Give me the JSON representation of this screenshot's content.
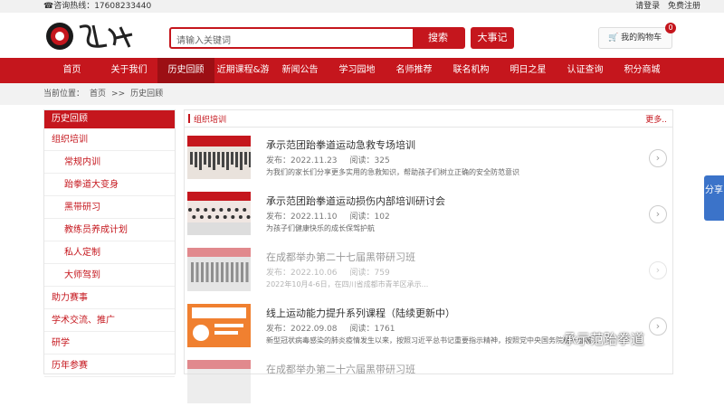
{
  "topbar": {
    "hotline": "☎咨询热线：17608233440",
    "login": "请登录",
    "register": "免费注册"
  },
  "header": {
    "search_placeholder": "请输入关键词",
    "search_button": "搜索",
    "big_event_button": "大事记",
    "cart_label": "我的购物车",
    "cart_count": "0"
  },
  "nav": {
    "items": [
      "首页",
      "关于我们",
      "历史回顾",
      "近期课程&游学",
      "新闻公告",
      "学习园地",
      "名师推荐",
      "联名机构",
      "明日之星",
      "认证查询",
      "积分商城"
    ],
    "active_index": 2
  },
  "breadcrumb": {
    "label": "当前位置：",
    "home": "首页",
    "sep": ">>",
    "current": "历史回顾"
  },
  "sidebar": {
    "title": "历史回顾",
    "items": [
      {
        "label": "组织培训",
        "sub": false
      },
      {
        "label": "常规内训",
        "sub": true
      },
      {
        "label": "跆拳道大变身",
        "sub": true
      },
      {
        "label": "黑带研习",
        "sub": true
      },
      {
        "label": "教练员养成计划",
        "sub": true
      },
      {
        "label": "私人定制",
        "sub": true
      },
      {
        "label": "大师驾到",
        "sub": true
      },
      {
        "label": "助力赛事",
        "sub": false
      },
      {
        "label": "学术交流、推广",
        "sub": false
      },
      {
        "label": "研学",
        "sub": false
      },
      {
        "label": "历年参赛",
        "sub": false
      }
    ]
  },
  "main": {
    "title": "组织培训",
    "more": "更多..",
    "articles": [
      {
        "title": "承示范团跆拳道运动急救专场培训",
        "date_label": "发布：2022.11.23",
        "views_label": "阅读：325",
        "desc": "为我们的家长们分享更多实用的急救知识，帮助孩子们树立正确的安全防范意识"
      },
      {
        "title": "承示范团跆拳道运动损伤内部培训研讨会",
        "date_label": "发布：2022.11.10",
        "views_label": "阅读：102",
        "desc": "为孩子们健康快乐的成长保驾护航"
      },
      {
        "title": "在成都举办第二十七届黑带研习班",
        "date_label": "发布：2022.10.06",
        "views_label": "阅读：759",
        "desc": "2022年10月4-6日，在四川省成都市青羊区承示..."
      },
      {
        "title": "线上运动能力提升系列课程（陆续更新中）",
        "date_label": "发布：2022.09.08",
        "views_label": "阅读：1761",
        "desc": "新型冠状病毒感染的肺炎疫情发生以来，按照习近平总书记重要指示精神，按照党中央国务院统一部署..."
      },
      {
        "title": "在成都举办第二十六届黑带研习班",
        "date_label": "",
        "views_label": "",
        "desc": ""
      }
    ]
  },
  "share": {
    "label": "分享"
  },
  "watermark": "承示范跆拳道",
  "colors": {
    "brand": "#c5161d",
    "share": "#3b73c9"
  }
}
